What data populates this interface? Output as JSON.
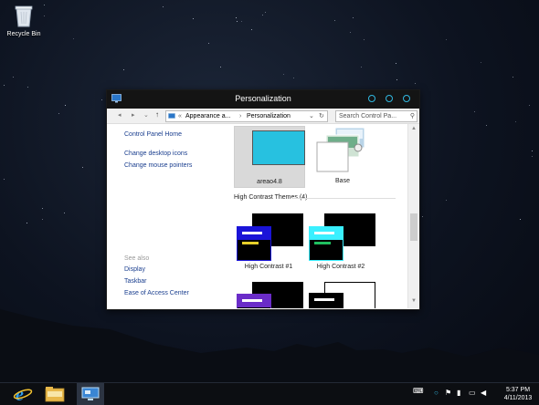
{
  "desktop": {
    "icons": [
      {
        "label": "Recycle Bin",
        "icon": "recycle-bin-icon"
      }
    ]
  },
  "window": {
    "title": "Personalization",
    "app_icon": "personalization-icon",
    "address": {
      "nav_back": "◂",
      "nav_forward": "▸",
      "nav_up": "↑",
      "chevron": "«",
      "crumbs": [
        "Appearance a...",
        "Personalization"
      ],
      "separator": "›",
      "dropdown": "⌄",
      "refresh": "↻"
    },
    "search": {
      "placeholder": "Search Control Pa..."
    },
    "left_pane": {
      "home_link": "Control Panel Home",
      "links": [
        "Change desktop icons",
        "Change mouse pointers"
      ],
      "see_also_label": "See also",
      "see_also_links": [
        "Display",
        "Taskbar",
        "Ease of Access Center"
      ]
    },
    "themes": {
      "selected": {
        "name": "areao4.8",
        "accent": "#27c1e0"
      },
      "other": {
        "name": "Base"
      },
      "section_title": "High Contrast Themes (4)",
      "high_contrast": [
        {
          "name": "High Contrast #1",
          "box_color": "#1a14d8",
          "bar1": "#ffffff",
          "bar2": "#e8d02a"
        },
        {
          "name": "High Contrast #2",
          "box_color": "#3af0ff",
          "bar1": "#ffffff",
          "bar2": "#20c060"
        }
      ]
    }
  },
  "taskbar": {
    "apps": [
      {
        "name": "Internet Explorer",
        "icon": "internet-explorer-icon"
      },
      {
        "name": "File Explorer",
        "icon": "file-explorer-icon"
      },
      {
        "name": "Control Panel",
        "icon": "control-panel-icon"
      }
    ],
    "tray_icons": [
      "keyboard-icon",
      "circle-icon",
      "flag-icon",
      "network-icon",
      "display-icon",
      "volume-icon"
    ],
    "time": "5:37 PM",
    "date": "4/11/2013"
  }
}
